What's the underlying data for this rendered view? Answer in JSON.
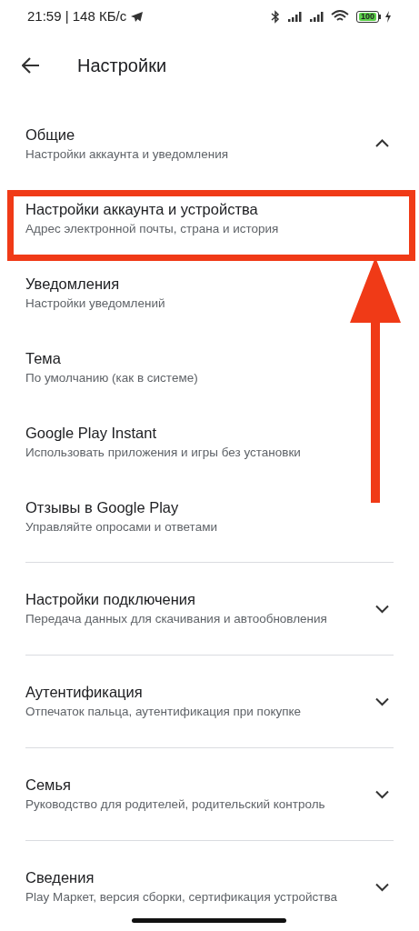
{
  "status_bar": {
    "time": "21:59 | 148 КБ/с",
    "battery": "100"
  },
  "header": {
    "title": "Настройки"
  },
  "sections": [
    {
      "title": "Общие",
      "subtitle": "Настройки аккаунта и уведомления",
      "expanded": true,
      "items": [
        {
          "title": "Настройки аккаунта и устройства",
          "subtitle": "Адрес электронной почты, страна и история",
          "highlighted": true
        },
        {
          "title": "Уведомления",
          "subtitle": "Настройки уведомлений",
          "highlighted": false
        },
        {
          "title": "Тема",
          "subtitle": "По умолчанию (как в системе)",
          "highlighted": false
        },
        {
          "title": "Google Play Instant",
          "subtitle": "Использовать приложения и игры без установки",
          "highlighted": false
        },
        {
          "title": "Отзывы в Google Play",
          "subtitle": "Управляйте опросами и ответами",
          "highlighted": false
        }
      ]
    },
    {
      "title": "Настройки подключения",
      "subtitle": "Передача данных для скачивания и автообновления",
      "expanded": false
    },
    {
      "title": "Аутентификация",
      "subtitle": "Отпечаток пальца, аутентификация при покупке",
      "expanded": false
    },
    {
      "title": "Семья",
      "subtitle": "Руководство для родителей, родительский контроль",
      "expanded": false
    },
    {
      "title": "Сведения",
      "subtitle": "Play Маркет, версия сборки, сертификация устройства",
      "expanded": false
    }
  ]
}
